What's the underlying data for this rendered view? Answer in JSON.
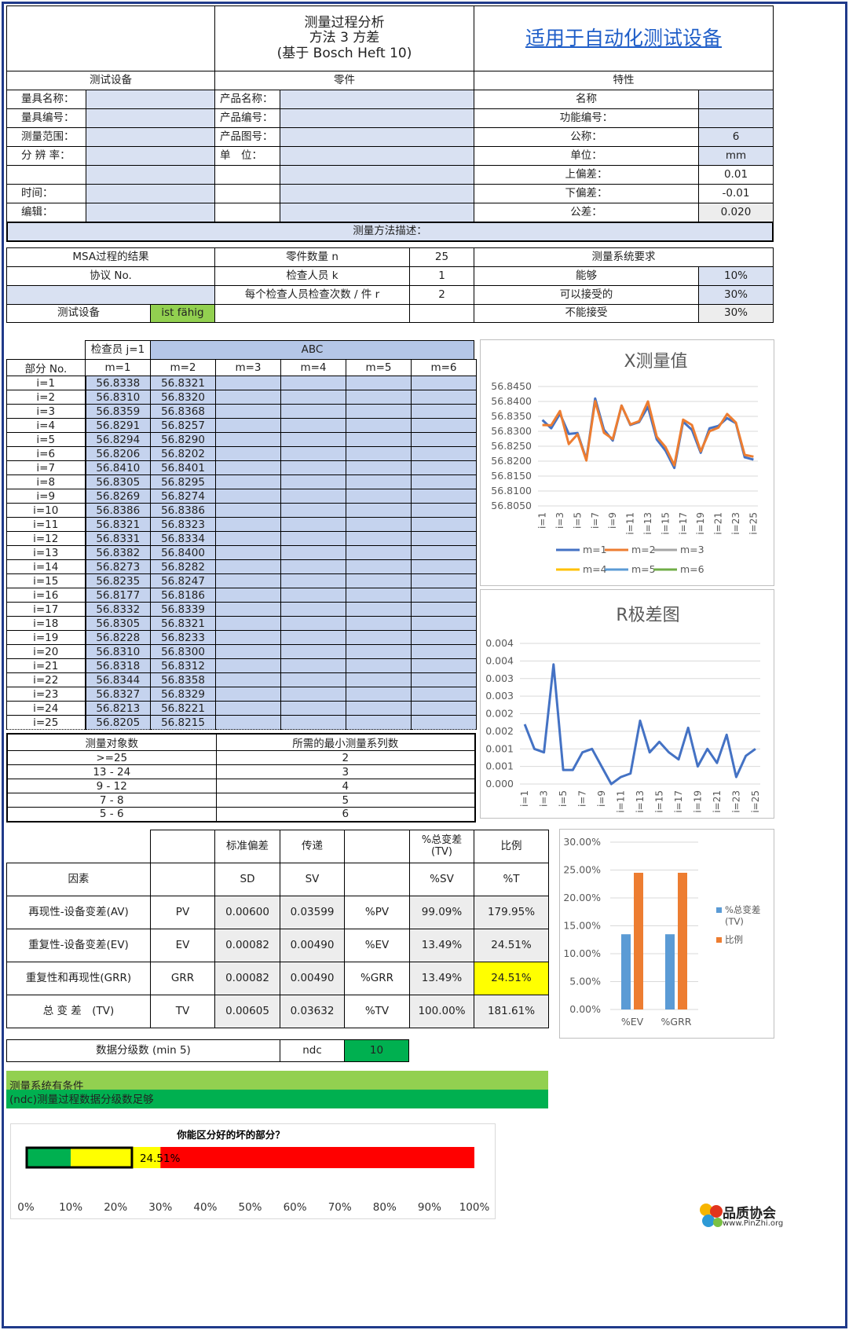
{
  "header": {
    "title1": "测量过程分析",
    "title2": "方法 3 方差",
    "title3": "(基于 Bosch Heft 10)",
    "link": "适用于自动化测试设备"
  },
  "sections": {
    "equipment": "测试设备",
    "part": "零件",
    "characteristic": "特性"
  },
  "equipment": {
    "name_label": "量具名称：",
    "no_label": "量具编号：",
    "range_label": "测量范围：",
    "resolution_label": "分 辨 率：",
    "time_label": "时间：",
    "editor_label": "编辑："
  },
  "part": {
    "name_label": "产品名称：",
    "no_label": "产品编号：",
    "drawing_label": "产品图号：",
    "unit_label": "单　位："
  },
  "characteristic": {
    "name_label": "名称",
    "func_label": "功能编号：",
    "nominal_label": "公称：",
    "nominal": "6",
    "unit_label": "单位：",
    "unit": "mm",
    "upper_label": "上偏差：",
    "upper": "0.01",
    "lower_label": "下偏差：",
    "lower": "-0.01",
    "tol_label": "公差：",
    "tol": "0.020"
  },
  "method_desc": "测量方法描述：",
  "msa": {
    "result_label": "MSA过程的结果",
    "protocol_label": "协议 No.",
    "device_label": "测试设备",
    "device_status": "ist fähig",
    "parts_label": "零件数量 n",
    "parts": "25",
    "operators_label": "检查人员 k",
    "operators": "1",
    "trials_label": "每个检查人员检查次数 / 件 r",
    "trials": "2",
    "req_label": "测量系统要求",
    "capable_label": "能够",
    "capable": "10%",
    "acceptable_label": "可以接受的",
    "acceptable": "30%",
    "not_acceptable_label": "不能接受",
    "not_acceptable": "30%"
  },
  "measure": {
    "operator_label": "检查员 j=1",
    "operator_name": "ABC",
    "part_no_label": "部分 No.",
    "cols": [
      "m=1",
      "m=2",
      "m=3",
      "m=4",
      "m=5",
      "m=6"
    ],
    "rows": [
      [
        "i=1",
        "56.8338",
        "56.8321"
      ],
      [
        "i=2",
        "56.8310",
        "56.8320"
      ],
      [
        "i=3",
        "56.8359",
        "56.8368"
      ],
      [
        "i=4",
        "56.8291",
        "56.8257"
      ],
      [
        "i=5",
        "56.8294",
        "56.8290"
      ],
      [
        "i=6",
        "56.8206",
        "56.8202"
      ],
      [
        "i=7",
        "56.8410",
        "56.8401"
      ],
      [
        "i=8",
        "56.8305",
        "56.8295"
      ],
      [
        "i=9",
        "56.8269",
        "56.8274"
      ],
      [
        "i=10",
        "56.8386",
        "56.8386"
      ],
      [
        "i=11",
        "56.8321",
        "56.8323"
      ],
      [
        "i=12",
        "56.8331",
        "56.8334"
      ],
      [
        "i=13",
        "56.8382",
        "56.8400"
      ],
      [
        "i=14",
        "56.8273",
        "56.8282"
      ],
      [
        "i=15",
        "56.8235",
        "56.8247"
      ],
      [
        "i=16",
        "56.8177",
        "56.8186"
      ],
      [
        "i=17",
        "56.8332",
        "56.8339"
      ],
      [
        "i=18",
        "56.8305",
        "56.8321"
      ],
      [
        "i=19",
        "56.8228",
        "56.8233"
      ],
      [
        "i=20",
        "56.8310",
        "56.8300"
      ],
      [
        "i=21",
        "56.8318",
        "56.8312"
      ],
      [
        "i=22",
        "56.8344",
        "56.8358"
      ],
      [
        "i=23",
        "56.8327",
        "56.8329"
      ],
      [
        "i=24",
        "56.8213",
        "56.8221"
      ],
      [
        "i=25",
        "56.8205",
        "56.8215"
      ]
    ]
  },
  "min_series": {
    "h1": "测量对象数",
    "h2": "所需的最小测量系列数",
    "rows": [
      [
        ">=25",
        "2"
      ],
      [
        "13 - 24",
        "3"
      ],
      [
        "9 - 12",
        "4"
      ],
      [
        "7 - 8",
        "5"
      ],
      [
        "5 - 6",
        "6"
      ]
    ]
  },
  "results": {
    "h_sd": "标准偏差",
    "h_sv": "传递",
    "h_tv": "%总变差\n(TV)",
    "h_ratio": "比例",
    "factor": "因素",
    "sd": "SD",
    "sv": "SV",
    "psv": "%SV",
    "pt": "%T",
    "rows": [
      {
        "name": "再现性-设备变差(AV)",
        "code": "PV",
        "sd": "0.00600",
        "sv": "0.03599",
        "pcode": "%PV",
        "ptv": "99.09%",
        "ratio": "179.95%"
      },
      {
        "name": "重复性-设备变差(EV)",
        "code": "EV",
        "sd": "0.00082",
        "sv": "0.00490",
        "pcode": "%EV",
        "ptv": "13.49%",
        "ratio": "24.51%"
      },
      {
        "name": "重复性和再现性(GRR)",
        "code": "GRR",
        "sd": "0.00082",
        "sv": "0.00490",
        "pcode": "%GRR",
        "ptv": "13.49%",
        "ratio": "24.51%"
      },
      {
        "name": "总 变 差　(TV)",
        "code": "TV",
        "sd": "0.00605",
        "sv": "0.03632",
        "pcode": "%TV",
        "ptv": "100.00%",
        "ratio": "181.61%"
      }
    ],
    "ndc_label": "数据分级数 (min 5)",
    "ndc_code": "ndc",
    "ndc": "10",
    "status1": "测量系统有条件",
    "status2": "(ndc)测量过程数据分级数足够"
  },
  "chart_data": [
    {
      "type": "line",
      "title": "X测量值",
      "categories": [
        "i=1",
        "i=2",
        "i=3",
        "i=4",
        "i=5",
        "i=6",
        "i=7",
        "i=8",
        "i=9",
        "i=10",
        "i=11",
        "i=12",
        "i=13",
        "i=14",
        "i=15",
        "i=16",
        "i=17",
        "i=18",
        "i=19",
        "i=20",
        "i=21",
        "i=22",
        "i=23",
        "i=24",
        "i=25"
      ],
      "tick_labels": [
        "i=1",
        "i=3",
        "i=5",
        "i=7",
        "i=9",
        "i=11",
        "i=13",
        "i=15",
        "i=17",
        "i=19",
        "i=21",
        "i=23",
        "i=25"
      ],
      "ylim": [
        56.805,
        56.845
      ],
      "yticks": [
        "56.8450",
        "56.8400",
        "56.8350",
        "56.8300",
        "56.8250",
        "56.8200",
        "56.8150",
        "56.8100",
        "56.8050"
      ],
      "series": [
        {
          "name": "m=1",
          "color": "#4472c4",
          "values": [
            56.8338,
            56.831,
            56.8359,
            56.8291,
            56.8294,
            56.8206,
            56.841,
            56.8305,
            56.8269,
            56.8386,
            56.8321,
            56.8331,
            56.8382,
            56.8273,
            56.8235,
            56.8177,
            56.8332,
            56.8305,
            56.8228,
            56.831,
            56.8318,
            56.8344,
            56.8327,
            56.8213,
            56.8205
          ]
        },
        {
          "name": "m=2",
          "color": "#ed7d31",
          "values": [
            56.8321,
            56.832,
            56.8368,
            56.8257,
            56.829,
            56.8202,
            56.8401,
            56.8295,
            56.8274,
            56.8386,
            56.8323,
            56.8334,
            56.84,
            56.8282,
            56.8247,
            56.8186,
            56.8339,
            56.8321,
            56.8233,
            56.83,
            56.8312,
            56.8358,
            56.8329,
            56.8221,
            56.8215
          ]
        },
        {
          "name": "m=3",
          "color": "#a5a5a5",
          "values": []
        },
        {
          "name": "m=4",
          "color": "#ffc000",
          "values": []
        },
        {
          "name": "m=5",
          "color": "#5b9bd5",
          "values": []
        },
        {
          "name": "m=6",
          "color": "#70ad47",
          "values": []
        }
      ],
      "legend": "bottom"
    },
    {
      "type": "line",
      "title": "R极差图",
      "categories": [
        "i=1",
        "i=2",
        "i=3",
        "i=4",
        "i=5",
        "i=6",
        "i=7",
        "i=8",
        "i=9",
        "i=10",
        "i=11",
        "i=12",
        "i=13",
        "i=14",
        "i=15",
        "i=16",
        "i=17",
        "i=18",
        "i=19",
        "i=20",
        "i=21",
        "i=22",
        "i=23",
        "i=24",
        "i=25"
      ],
      "tick_labels": [
        "i=1",
        "i=3",
        "i=5",
        "i=7",
        "i=9",
        "i=11",
        "i=13",
        "i=15",
        "i=17",
        "i=19",
        "i=21",
        "i=23",
        "i=25"
      ],
      "ylim": [
        0,
        0.004
      ],
      "yticks": [
        "0.004",
        "0.004",
        "0.003",
        "0.003",
        "0.002",
        "0.002",
        "0.001",
        "0.001",
        "0.000"
      ],
      "series": [
        {
          "name": "R",
          "color": "#4472c4",
          "values": [
            0.0017,
            0.001,
            0.0009,
            0.0034,
            0.0004,
            0.0004,
            0.0009,
            0.001,
            0.0005,
            0.0,
            0.0002,
            0.0003,
            0.0018,
            0.0009,
            0.0012,
            0.0009,
            0.0007,
            0.0016,
            0.0005,
            0.001,
            0.0006,
            0.0014,
            0.0002,
            0.0008,
            0.001
          ]
        }
      ]
    },
    {
      "type": "bar",
      "categories": [
        "%EV",
        "%GRR"
      ],
      "ylim": [
        0,
        0.3
      ],
      "yticks": [
        "30.00%",
        "25.00%",
        "20.00%",
        "15.00%",
        "10.00%",
        "5.00%",
        "0.00%"
      ],
      "series": [
        {
          "name": "%总变差\n(TV)",
          "color": "#5b9bd5",
          "values": [
            0.1349,
            0.1349
          ]
        },
        {
          "name": "比例",
          "color": "#ed7d31",
          "values": [
            0.2451,
            0.2451
          ]
        }
      ],
      "legend": "right"
    },
    {
      "type": "bar",
      "title": "你能区分好的坏的部分？",
      "orientation": "horizontal",
      "value": 0.2451,
      "value_label": "24.51%",
      "xticks": [
        "0%",
        "10%",
        "20%",
        "30%",
        "40%",
        "50%",
        "60%",
        "70%",
        "80%",
        "90%",
        "100%"
      ],
      "zones": [
        {
          "to": 0.1,
          "color": "#00b050"
        },
        {
          "to": 0.3,
          "color": "#ffff00"
        },
        {
          "to": 1.0,
          "color": "#ff0000"
        }
      ]
    }
  ],
  "logo": {
    "name": "品质协会",
    "url": "www.PinZhi.org"
  }
}
